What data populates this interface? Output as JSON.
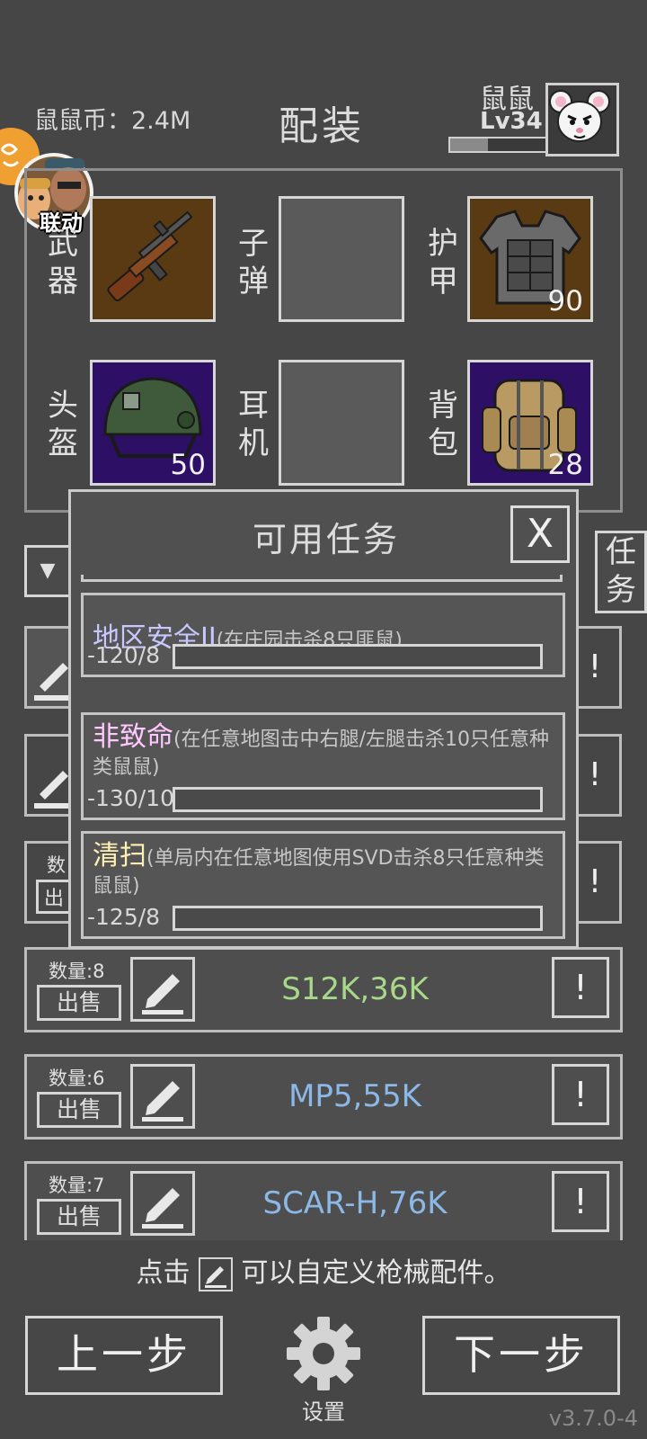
{
  "header": {
    "coins_label": "鼠鼠币：2.4M",
    "title": "配装",
    "player_name": "鼠鼠",
    "player_level": "Lv34",
    "xp_fraction": 0.4,
    "avatar_icon": "white-rat-avatar-icon"
  },
  "collab": {
    "label": "联动"
  },
  "equipment": {
    "slots": [
      {
        "label": "武器",
        "icon": "rifle-icon"
      },
      {
        "label": "子弹"
      },
      {
        "label": "护甲",
        "icon": "body-armor-icon",
        "value": "90"
      },
      {
        "label": "头盔",
        "icon": "helmet-icon",
        "value": "50"
      },
      {
        "label": "耳机"
      },
      {
        "label": "背包",
        "icon": "backpack-icon",
        "value": "28"
      }
    ]
  },
  "side_tab": {
    "label": "任务"
  },
  "modal": {
    "title": "可用任务",
    "close": "X",
    "tasks": [
      {
        "name": "地区安全II",
        "name_color": "#c8c8ff",
        "desc": "(在庄园击杀8只匪鼠)",
        "progress": "-120/8"
      },
      {
        "name": "非致命",
        "name_color": "#ffc8ff",
        "desc": "(在任意地图击中右腿/左腿击杀10只任意种类鼠鼠)",
        "progress": "-130/10"
      },
      {
        "name": "清扫",
        "name_color": "#fff0b4",
        "desc": "(单局内在任意地图使用SVD击杀8只任意种类鼠鼠)",
        "progress": "-125/8"
      }
    ]
  },
  "list": {
    "partial_qty": "数",
    "partial_sell": "出",
    "info_label": "!",
    "rows": [
      {
        "qty": "数量:8",
        "sell": "出售",
        "name": "S12K,36K",
        "color": "#a8d88a",
        "info": "!"
      },
      {
        "qty": "数量:6",
        "sell": "出售",
        "name": "MP5,55K",
        "color": "#8cb8e8",
        "info": "!"
      },
      {
        "qty": "数量:7",
        "sell": "出售",
        "name": "SCAR-H,76K",
        "color": "#8cb8e8",
        "info": "!"
      }
    ]
  },
  "hint": {
    "before": "点击",
    "after": "可以自定义枪械配件。"
  },
  "nav": {
    "prev": "上一步",
    "next": "下一步",
    "settings": "设置"
  },
  "version": "v3.7.0-4"
}
